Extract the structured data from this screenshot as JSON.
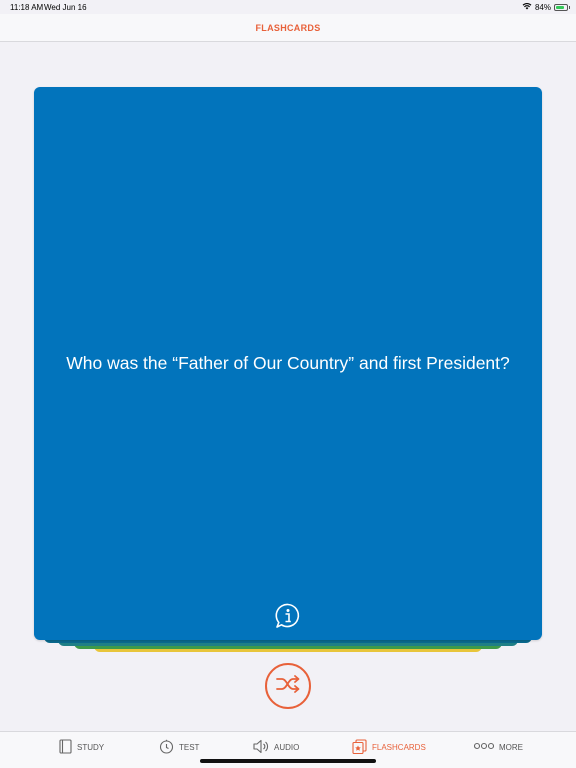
{
  "status": {
    "time": "11:18 AM",
    "date": "Wed Jun 16",
    "battery_percent": "84%",
    "battery_level": 0.84
  },
  "header": {
    "title": "FLASHCARDS"
  },
  "card": {
    "question": "Who was the “Father of Our Country” and first President?",
    "info_icon": "info-bubble-icon",
    "color": "#0274bc"
  },
  "stack_colors": [
    "#0a6a8e",
    "#1f7f86",
    "#3d9a4a",
    "#e8c53a"
  ],
  "shuffle": {
    "icon": "shuffle-icon"
  },
  "tabs": [
    {
      "label": "STUDY",
      "icon": "book-icon"
    },
    {
      "label": "TEST",
      "icon": "stopwatch-icon"
    },
    {
      "label": "AUDIO",
      "icon": "speaker-icon"
    },
    {
      "label": "FLASHCARDS",
      "icon": "flashcards-icon",
      "active": true
    },
    {
      "label": "MORE",
      "icon": "more-dots-icon"
    }
  ],
  "accent_color": "#e8613a"
}
